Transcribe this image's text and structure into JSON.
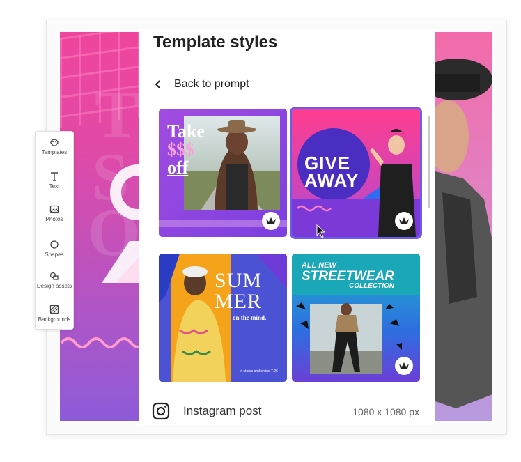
{
  "panel": {
    "title": "Template styles",
    "back_label": "Back to prompt"
  },
  "sidebar": {
    "items": [
      {
        "label": "Templates",
        "icon": "templates-icon"
      },
      {
        "label": "Text",
        "icon": "text-icon"
      },
      {
        "label": "Photos",
        "icon": "photos-icon"
      },
      {
        "label": "Shapes",
        "icon": "shapes-icon"
      },
      {
        "label": "Design assets",
        "icon": "design-assets-icon"
      },
      {
        "label": "Backgrounds",
        "icon": "backgrounds-icon"
      }
    ]
  },
  "templates": [
    {
      "lines": [
        "Take",
        "$$$",
        "off"
      ],
      "premium": true,
      "selected": false
    },
    {
      "lines": [
        "GIVE",
        "AWAY"
      ],
      "premium": true,
      "selected": true
    },
    {
      "lines": [
        "SUM",
        "MER",
        "on the mind.",
        "In stores and online 7.26"
      ],
      "premium": false,
      "selected": false
    },
    {
      "lines": [
        "ALL NEW",
        "STREETWEAR",
        "COLLECTION"
      ],
      "premium": true,
      "selected": false
    }
  ],
  "footer": {
    "format": "Instagram post",
    "dimensions": "1080 x 1080 px"
  },
  "colors": {
    "accent": "#6b5cf0",
    "pink": "#f0459c",
    "purple": "#8d5bd8",
    "orange": "#f5a31a",
    "teal": "#1fb3c9"
  }
}
